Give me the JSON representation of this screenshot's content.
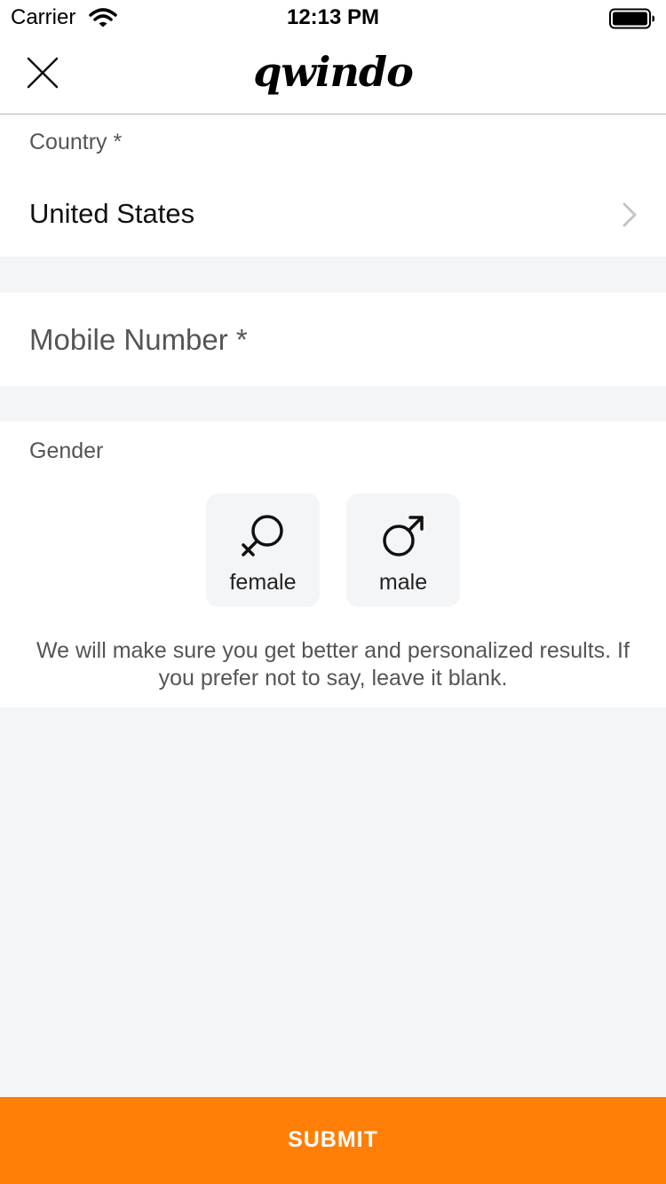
{
  "status_bar": {
    "carrier": "Carrier",
    "time": "12:13 PM"
  },
  "navbar": {
    "logo": "qwindo",
    "close_icon": "close-icon"
  },
  "country": {
    "label": "Country *",
    "value": "United States",
    "chevron_icon": "chevron-right-icon"
  },
  "mobile": {
    "placeholder": "Mobile Number *"
  },
  "gender": {
    "label": "Gender",
    "options": [
      {
        "label": "female",
        "icon": "female-symbol-icon"
      },
      {
        "label": "male",
        "icon": "male-symbol-icon"
      }
    ],
    "note": "We will make sure you get better and personalized results. If you prefer not to say, leave it blank."
  },
  "submit": {
    "label": "SUBMIT"
  },
  "colors": {
    "accent": "#ff7f07",
    "background": "#f4f5f7",
    "card": "#ffffff"
  }
}
